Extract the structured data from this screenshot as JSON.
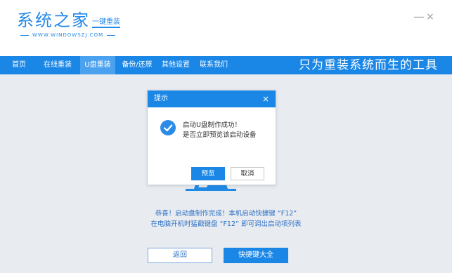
{
  "app": {
    "logo_title": "系统之家",
    "logo_subtitle": "一键重装",
    "logo_url": "WWW.WINDOWSZJ.COM",
    "minimize_glyph": "—",
    "close_glyph": "×"
  },
  "nav": {
    "items": [
      {
        "label": "首页"
      },
      {
        "label": "在线重装"
      },
      {
        "label": "U盘重装"
      },
      {
        "label": "备份/还原"
      },
      {
        "label": "其他设置"
      },
      {
        "label": "联系我们"
      }
    ],
    "active": "U盘重装",
    "slogan": "只为重装系统而生的工具"
  },
  "main": {
    "message_line1": "恭喜！启动盘制作完成！本机启动快捷键 “F12”",
    "message_line2": "在电脑开机时猛戳键盘 “F12” 即可调出启动项列表",
    "back_button": "返回",
    "shortcut_button": "快捷键大全"
  },
  "dialog": {
    "title": "提示",
    "close_glyph": "×",
    "line1": "启动U盘制作成功！",
    "line2": "是否立即预览该启动设备",
    "ok_button": "预览",
    "cancel_button": "取消"
  },
  "colors": {
    "primary": "#1a86e6",
    "nav_active": "#4aa2ef",
    "background": "#e8ebef",
    "message_text": "#2b6fc5",
    "check_icon": "#2d8be8"
  },
  "icons": {
    "dialog_icon": "check-circle-icon",
    "minimize": "minimize-icon",
    "close": "close-icon"
  }
}
